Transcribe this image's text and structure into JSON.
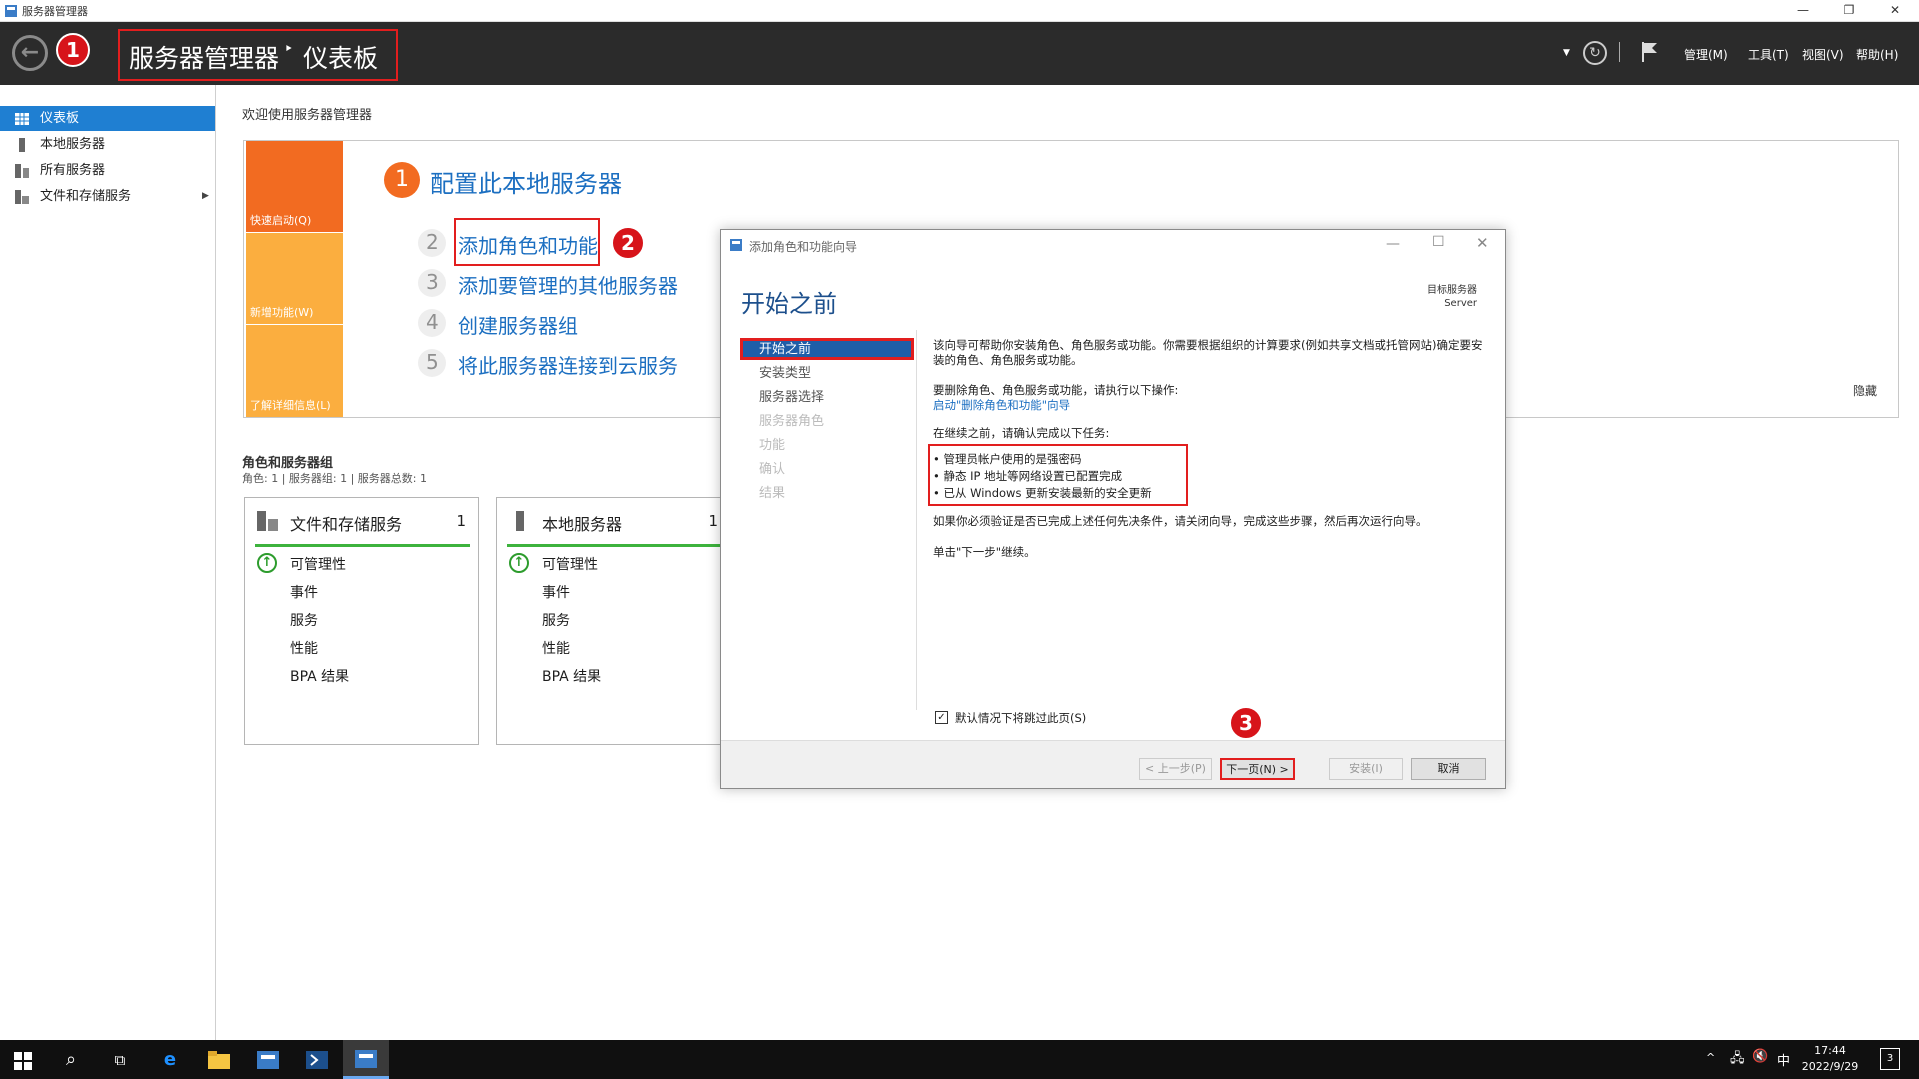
{
  "window": {
    "title": "服务器管理器",
    "min": "—",
    "restore": "❐",
    "close": "✕"
  },
  "header": {
    "crumb_app": "服务器管理器",
    "crumb_sep": "‣",
    "crumb_page": "仪表板",
    "menus": [
      "管理(M)",
      "工具(T)",
      "视图(V)",
      "帮助(H)"
    ],
    "badges": [
      "1",
      "2",
      "3"
    ]
  },
  "sidebar": {
    "items": [
      {
        "label": "仪表板",
        "icon": "dashboard-icon"
      },
      {
        "label": "本地服务器",
        "icon": "server-icon"
      },
      {
        "label": "所有服务器",
        "icon": "servers-icon"
      },
      {
        "label": "文件和存储服务",
        "icon": "storage-icon"
      }
    ]
  },
  "main": {
    "welcome": "欢迎使用服务器管理器",
    "tiles": [
      "快速启动(Q)",
      "新增功能(W)",
      "了解详细信息(L)"
    ],
    "hide": "隐藏",
    "step1": {
      "num": "1",
      "label": "配置此本地服务器"
    },
    "steps": [
      {
        "num": "2",
        "label": "添加角色和功能"
      },
      {
        "num": "3",
        "label": "添加要管理的其他服务器"
      },
      {
        "num": "4",
        "label": "创建服务器组"
      },
      {
        "num": "5",
        "label": "将此服务器连接到云服务"
      }
    ],
    "roles_title": "角色和服务器组",
    "roles_sub": "角色: 1 | 服务器组: 1 | 服务器总数: 1",
    "cards": [
      {
        "title": "文件和存储服务",
        "count": "1",
        "rows": [
          "可管理性",
          "事件",
          "服务",
          "性能",
          "BPA 结果"
        ]
      },
      {
        "title": "本地服务器",
        "count": "1",
        "rows": [
          "可管理性",
          "事件",
          "服务",
          "性能",
          "BPA 结果"
        ]
      }
    ]
  },
  "dialog": {
    "title": "添加角色和功能向导",
    "heading": "开始之前",
    "target_label": "目标服务器",
    "target_value": "Server",
    "nav": [
      "开始之前",
      "安装类型",
      "服务器选择",
      "服务器角色",
      "功能",
      "确认",
      "结果"
    ],
    "p1": "该向导可帮助你安装角色、角色服务或功能。你需要根据组织的计算要求(例如共享文档或托管网站)确定要安装的角色、角色服务或功能。",
    "p2": "要删除角色、角色服务或功能，请执行以下操作:",
    "p2_link": "启动\"删除角色和功能\"向导",
    "p3": "在继续之前，请确认完成以下任务:",
    "bullets": [
      "管理员帐户使用的是强密码",
      "静态 IP 地址等网络设置已配置完成",
      "已从 Windows 更新安装最新的安全更新"
    ],
    "p4": "如果你必须验证是否已完成上述任何先决条件，请关闭向导，完成这些步骤，然后再次运行向导。",
    "p5": "单击\"下一步\"继续。",
    "skip_label": "默认情况下将跳过此页(S)",
    "buttons": {
      "prev": "< 上一步(P)",
      "next": "下一页(N) >",
      "install": "安装(I)",
      "cancel": "取消"
    }
  },
  "taskbar": {
    "time": "17:44",
    "date": "2022/9/29",
    "ime": "中",
    "notif": "3"
  }
}
